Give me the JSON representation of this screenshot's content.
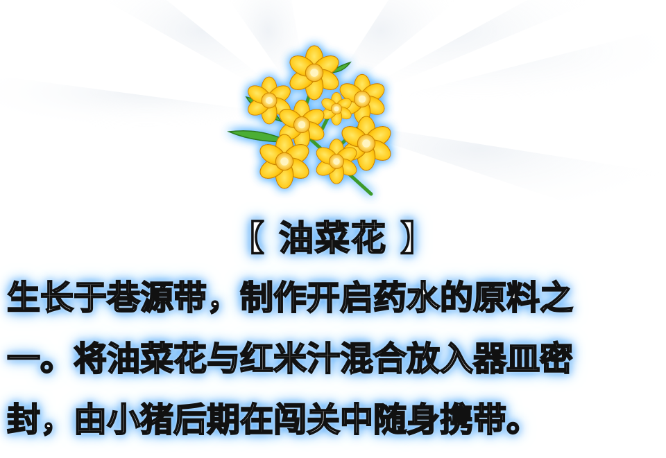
{
  "item": {
    "icon": "rapeseed-flower-bouquet-icon",
    "title": "【 油菜花 】",
    "description_lines": [
      "生长于巷源带，制作开启药水的原料之",
      "一。将油菜花与红米汁混合放入器皿密",
      "封，由小猪后期在闯关中随身携带。"
    ]
  },
  "colors": {
    "glow": "#4aa8ff",
    "text_fill": "#ffffff",
    "text_outline": "#111111",
    "petal": "#ffc814",
    "petal_dark": "#e59a00",
    "stem": "#3c9a2a"
  }
}
